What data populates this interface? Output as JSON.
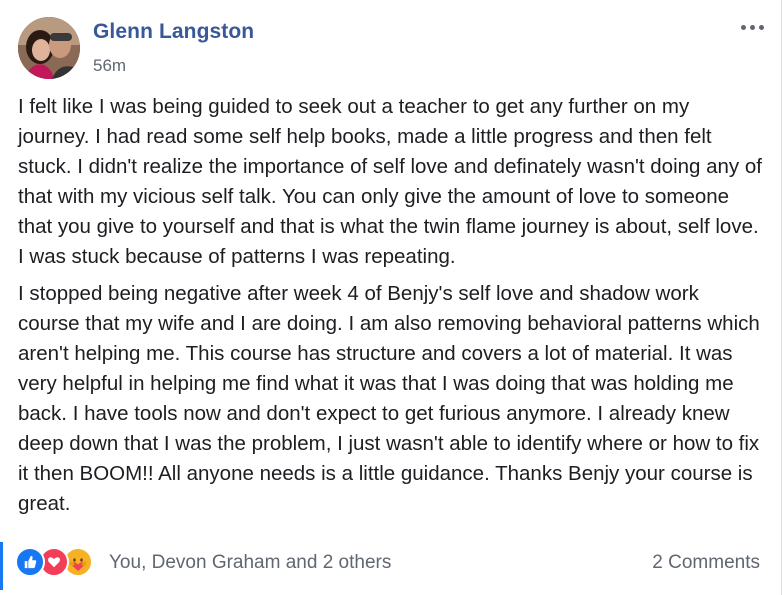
{
  "post": {
    "author": "Glenn Langston",
    "timestamp": "56m",
    "paragraphs": [
      "I felt like I was being guided to seek out a teacher to get any further on my journey. I had read some self help books, made a little progress and then felt stuck. I didn't realize the importance of self love and definately wasn't doing any of that with my vicious self talk. You can only give the amount of love to someone that you give to yourself and that is what the twin flame journey is about, self love. I was stuck because of patterns I was repeating.",
      "I stopped being negative after week 4 of Benjy's self love and shadow work course that my wife and I are doing. I am also removing behavioral patterns which aren't helping me. This course has structure and covers a lot of material. It was very helpful in helping me find what it was that I was doing that was holding me back. I have tools now and don't expect to get furious anymore. I already knew deep down that I was the problem, I just wasn't able to identify where or how to fix it then BOOM!! All anyone needs is a little guidance. Thanks Benjy your course is great."
    ]
  },
  "footer": {
    "reaction_icons": [
      "like-icon",
      "love-icon",
      "care-icon"
    ],
    "reactors_text": "You, Devon Graham and 2 others",
    "comments_text": "2 Comments"
  },
  "colors": {
    "author": "#385898",
    "secondary_text": "#606770",
    "like": "#1877f2",
    "love": "#f33e58",
    "care": "#f7b125"
  }
}
